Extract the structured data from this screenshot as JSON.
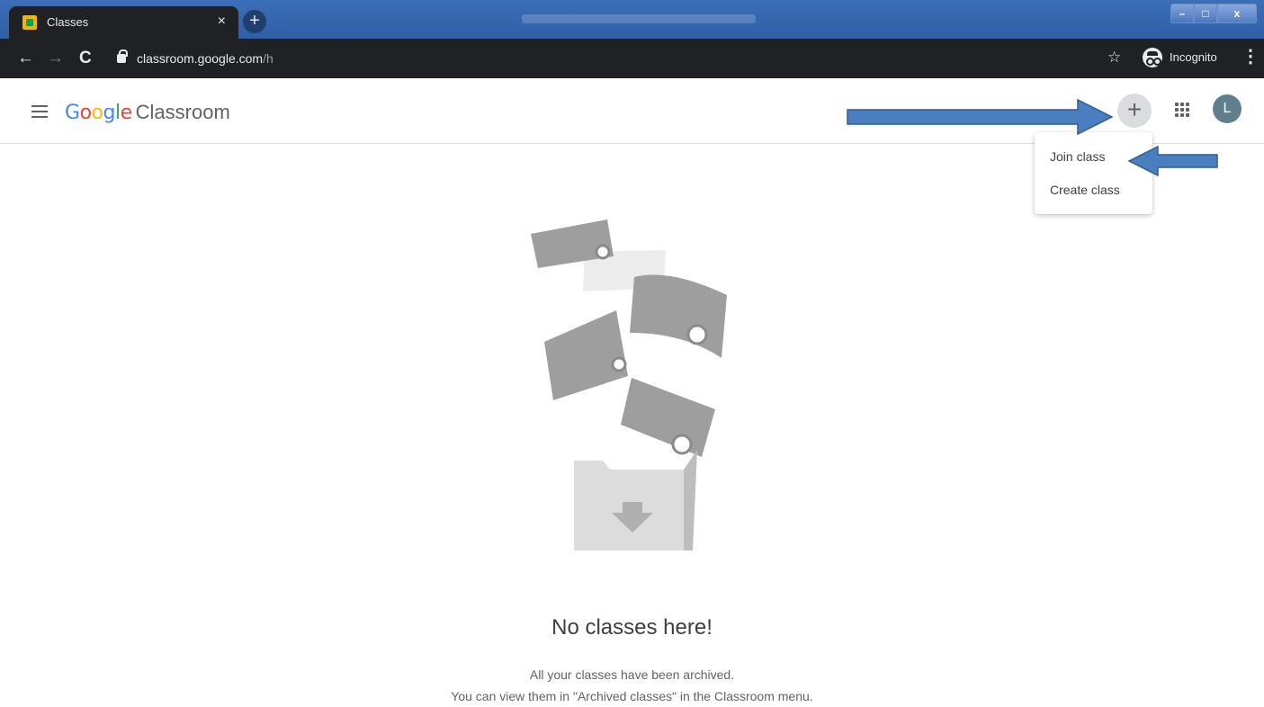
{
  "browser": {
    "tab_title": "Classes",
    "tab_close": "×",
    "new_tab": "+",
    "url_host": "classroom.google.com",
    "url_path": "/h",
    "incognito_label": "Incognito",
    "window_buttons": {
      "minimize": "–",
      "maximize": "□",
      "close": "x"
    }
  },
  "header": {
    "brand_google": [
      "G",
      "o",
      "o",
      "g",
      "l",
      "e"
    ],
    "brand_product": "Classroom",
    "add_button": "+",
    "avatar_letter": "L"
  },
  "menu": {
    "items": [
      {
        "label": "Join class"
      },
      {
        "label": "Create class"
      }
    ]
  },
  "empty_state": {
    "title": "No classes here!",
    "line1": "All your classes have been archived.",
    "line2": "You can view them in \"Archived classes\" in the Classroom menu."
  },
  "colors": {
    "chrome_bg": "#202124",
    "title_bar": "#2f5fa6",
    "annotation_arrow": "#4a7fbf",
    "google_blue": "#4285f4",
    "google_red": "#ea4335",
    "google_yellow": "#fbbc05",
    "google_green": "#34a853"
  },
  "icons": [
    "classroom-favicon",
    "back-icon",
    "forward-icon",
    "reload-icon",
    "lock-icon",
    "star-icon",
    "incognito-icon",
    "kebab-menu-icon",
    "hamburger-icon",
    "apps-grid-icon"
  ]
}
